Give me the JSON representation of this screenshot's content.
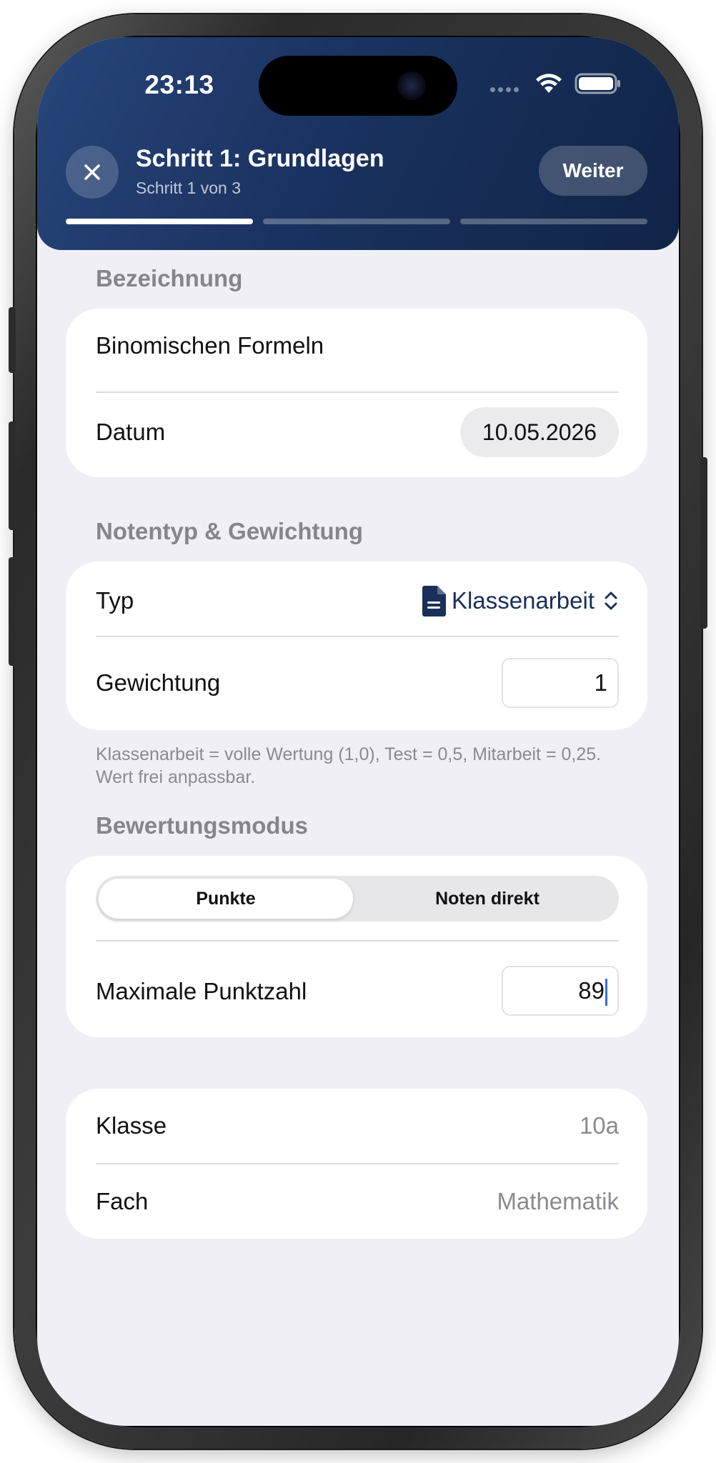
{
  "status_bar": {
    "time": "23:13"
  },
  "header": {
    "title": "Schritt 1: Grundlagen",
    "subtitle": "Schritt 1 von 3",
    "next_label": "Weiter",
    "progress": {
      "current_step": 1,
      "total_steps": 3
    },
    "colors": {
      "gradient_start": "#27467a",
      "gradient_end": "#102447"
    }
  },
  "bezeichnung": {
    "section_title": "Bezeichnung",
    "name_value": "Binomischen Formeln",
    "date_label": "Datum",
    "date_value": "10.05.2026"
  },
  "notentyp": {
    "section_title": "Notentyp & Gewichtung",
    "type_label": "Typ",
    "type_icon": "document-icon",
    "type_value": "Klassenarbeit",
    "weight_label": "Gewichtung",
    "weight_value": "1",
    "footnote": "Klassenarbeit = volle Wertung (1,0), Test = 0,5, Mitarbeit = 0,25. Wert frei anpassbar."
  },
  "bewertungsmodus": {
    "section_title": "Bewertungsmodus",
    "segments": [
      "Punkte",
      "Noten direkt"
    ],
    "selected_segment": "Punkte",
    "max_points_label": "Maximale Punktzahl",
    "max_points_value": "89"
  },
  "context": {
    "class_label": "Klasse",
    "class_value": "10a",
    "subject_label": "Fach",
    "subject_value": "Mathematik"
  },
  "colors": {
    "accent": "#1a2f5a",
    "background": "#f0eff5",
    "cursor": "#2f6fe4"
  }
}
